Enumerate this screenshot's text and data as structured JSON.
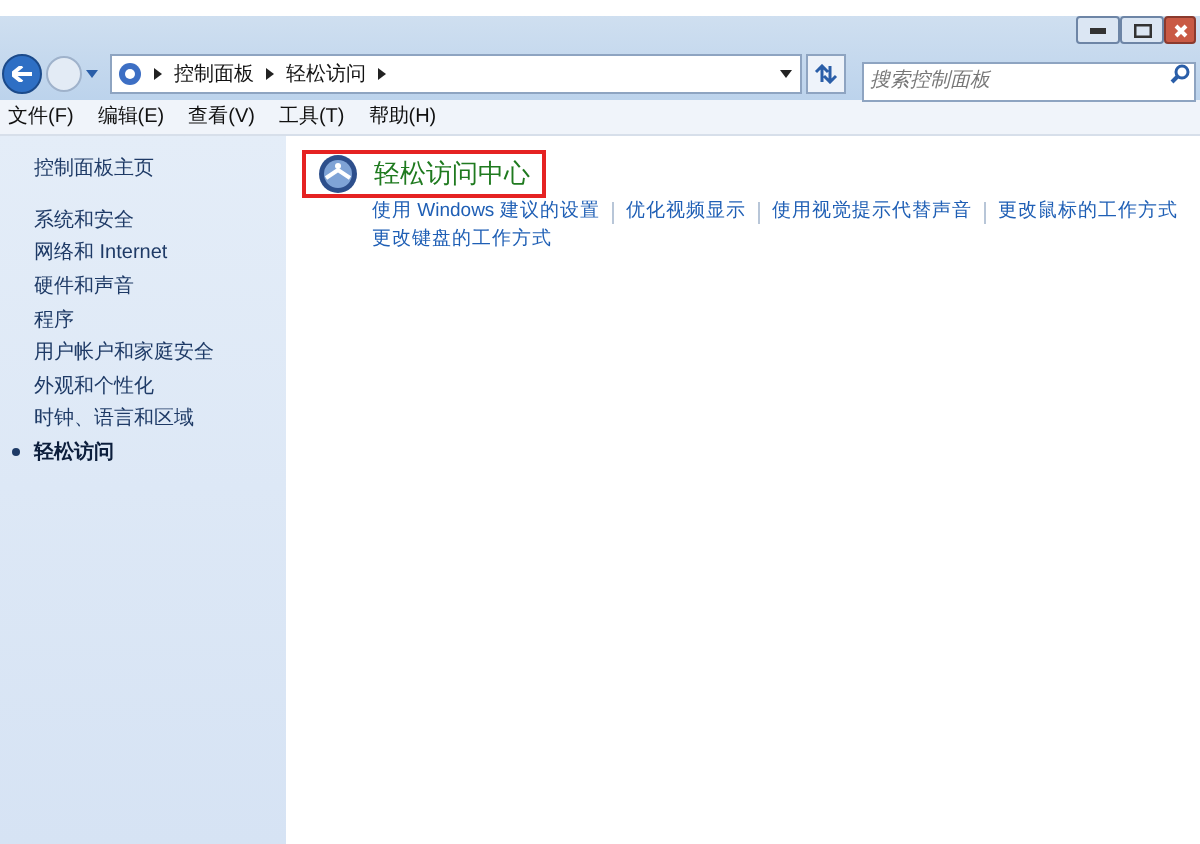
{
  "address_bar": {
    "breadcrumbs": [
      "控制面板",
      "轻松访问"
    ]
  },
  "search": {
    "placeholder": "搜索控制面板"
  },
  "menu": [
    "文件(F)",
    "编辑(E)",
    "查看(V)",
    "工具(T)",
    "帮助(H)"
  ],
  "sidebar": {
    "home": "控制面板主页",
    "items": [
      {
        "label": "系统和安全",
        "selected": false
      },
      {
        "label": "网络和 Internet",
        "selected": false
      },
      {
        "label": "硬件和声音",
        "selected": false
      },
      {
        "label": "程序",
        "selected": false
      },
      {
        "label": "用户帐户和家庭安全",
        "selected": false
      },
      {
        "label": "外观和个性化",
        "selected": false
      },
      {
        "label": "时钟、语言和区域",
        "selected": false
      },
      {
        "label": "轻松访问",
        "selected": true
      }
    ]
  },
  "main": {
    "title": "轻松访问中心",
    "highlighted": true,
    "links": [
      "使用 Windows 建议的设置",
      "优化视频显示",
      "使用视觉提示代替声音",
      "更改鼠标的工作方式",
      "更改键盘的工作方式"
    ]
  }
}
